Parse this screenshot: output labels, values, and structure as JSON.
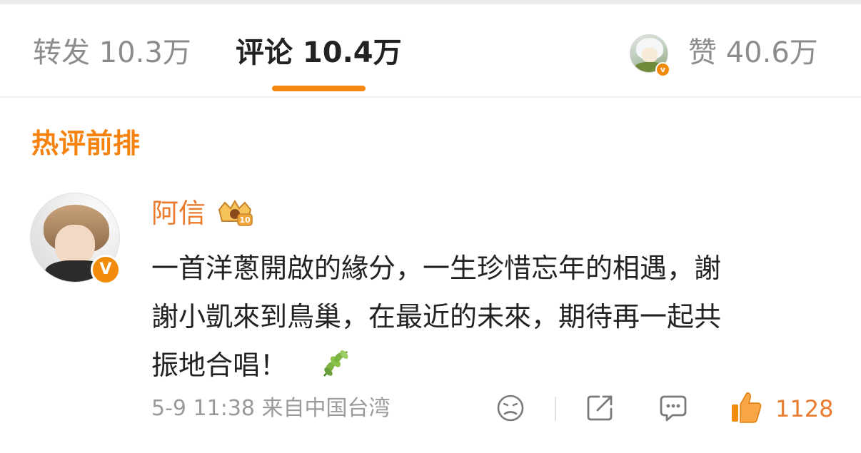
{
  "tabs": {
    "repost_label": "转发 10.3万",
    "comment_label": "评论 10.4万",
    "like_label": "赞 40.6万"
  },
  "section": {
    "title": "热评前排"
  },
  "comment": {
    "username": "阿信",
    "vip_level": "10",
    "verify_badge": "V",
    "text_lines": [
      "一首洋蔥開啟的緣分，一生珍惜忘年的相遇，謝",
      "謝小凱來到鳥巢，在最近的未來，期待再一起共",
      "振地合唱！"
    ],
    "time": "5-9 11:38",
    "location": "来自中国台湾",
    "likes": "1128"
  },
  "icons": {
    "emoji": "sad-face-icon",
    "share": "share-icon",
    "reply": "comment-bubble-icon",
    "like": "thumbs-up-icon",
    "leaf": "olive-branch-icon"
  },
  "colors": {
    "accent": "#f5860f",
    "username": "#eb7b2d",
    "text": "#222222",
    "muted": "#9a9a9a"
  }
}
